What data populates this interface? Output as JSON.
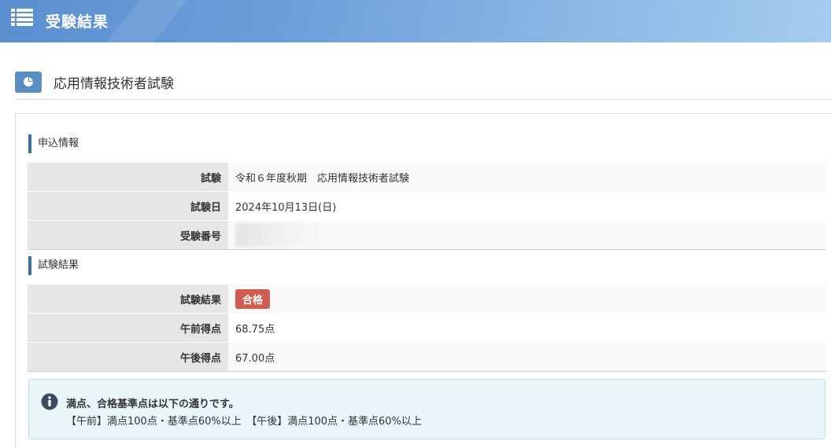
{
  "header": {
    "title": "受験結果",
    "icon": "list-icon"
  },
  "exam": {
    "title": "応用情報技術者試験",
    "icon": "pie-chart-icon"
  },
  "application": {
    "section_label": "申込情報",
    "rows": [
      {
        "label": "試験",
        "value": "令和６年度秋期　応用情報技術者試験"
      },
      {
        "label": "試験日",
        "value": "2024年10月13日(日)"
      },
      {
        "label": "受験番号",
        "value": ""
      }
    ]
  },
  "results": {
    "section_label": "試験結果",
    "rows": [
      {
        "label": "試験結果",
        "value": "合格"
      },
      {
        "label": "午前得点",
        "value": "68.75点"
      },
      {
        "label": "午後得点",
        "value": "67.00点"
      }
    ]
  },
  "notice": {
    "title": "満点、合格基準点は以下の通りです。",
    "detail": "【午前】満点100点・基準点60%以上　【午後】満点100点・基準点60%以上",
    "icon": "info-icon"
  },
  "colors": {
    "header_gradient_start": "#5a8fd0",
    "header_gradient_end": "#a6ccef",
    "pass_badge": "#d05d4f",
    "section_accent": "#3f6f9f",
    "notice_bg": "#e9f5f9"
  }
}
